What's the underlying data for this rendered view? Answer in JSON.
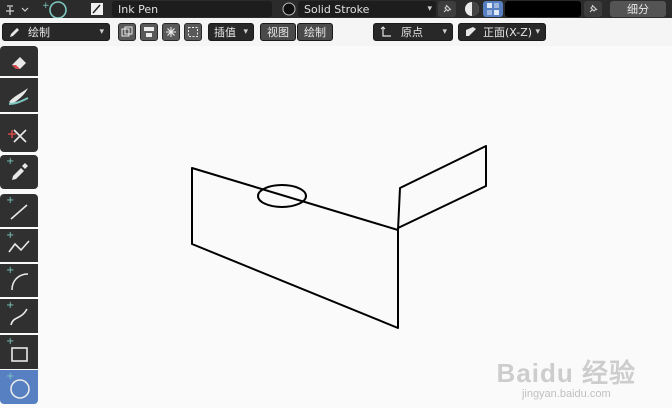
{
  "topbar": {
    "brush_name": "Ink Pen",
    "material_name": "Solid Stroke",
    "subdivide_label": "细分",
    "material_color": "#000000"
  },
  "header": {
    "mode_label": "绘制",
    "interpolate_label": "插值",
    "view_label": "视图",
    "draw_label": "绘制",
    "origin_label": "原点",
    "orientation_label": "正面(X-Z)"
  },
  "toolbar": {
    "tools": [
      "erase-icon",
      "tint-icon",
      "cutter-icon",
      "eyedropper-icon",
      "line-icon",
      "polyline-icon",
      "arc-icon",
      "curve-icon",
      "box-icon",
      "circle-icon"
    ],
    "active_tool": "circle-icon",
    "accent_color": "#5680c2"
  },
  "watermark": {
    "logo": "Baidu 经验",
    "url": "jingyan.baidu.com"
  }
}
